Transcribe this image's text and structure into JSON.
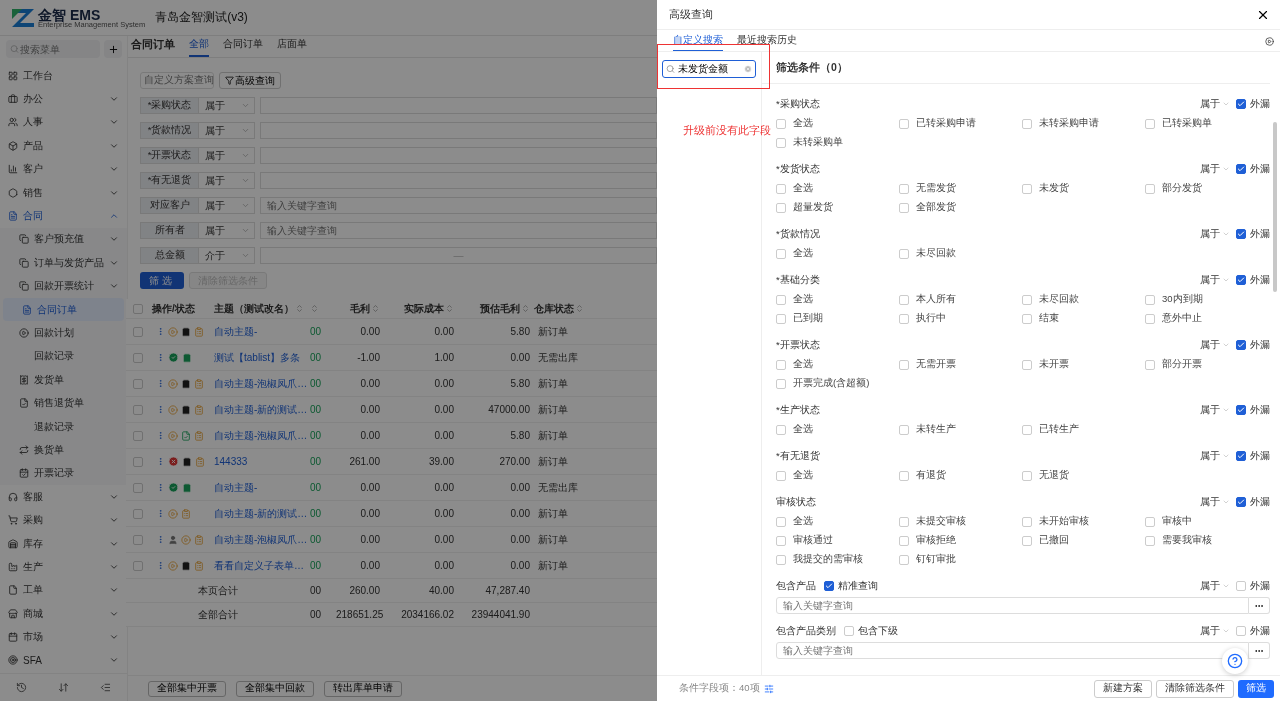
{
  "app": {
    "logo_text": "金智 EMS",
    "logo_subtitle": "Enterprise Management System",
    "title": "青岛金智测试(v3)"
  },
  "sidebar": {
    "search_placeholder": "搜索菜单",
    "items": [
      {
        "label": "工作台",
        "kind": "link",
        "selected": false
      },
      {
        "label": "办公",
        "kind": "group",
        "selected": false,
        "expanded": false
      },
      {
        "label": "人事",
        "kind": "group",
        "selected": false,
        "expanded": false
      },
      {
        "label": "产品",
        "kind": "group",
        "selected": false,
        "expanded": false
      },
      {
        "label": "客户",
        "kind": "group",
        "selected": false,
        "expanded": false
      },
      {
        "label": "销售",
        "kind": "group",
        "selected": false,
        "expanded": false
      },
      {
        "label": "合同",
        "kind": "group",
        "selected": false,
        "expanded": true,
        "children": [
          {
            "label": "客户预充值",
            "kind": "group",
            "selected": false,
            "expanded": false
          },
          {
            "label": "订单与发货产品",
            "kind": "group",
            "selected": false,
            "expanded": false
          },
          {
            "label": "回款开票统计",
            "kind": "group",
            "selected": false,
            "expanded": false
          },
          {
            "label": "合同订单",
            "kind": "link",
            "selected": true
          },
          {
            "label": "回款计划",
            "kind": "link",
            "selected": false
          },
          {
            "label": "回款记录",
            "kind": "plain",
            "selected": false
          },
          {
            "label": "发货单",
            "kind": "link",
            "selected": false
          },
          {
            "label": "销售退货单",
            "kind": "link",
            "selected": false
          },
          {
            "label": "退款记录",
            "kind": "plain",
            "selected": false
          },
          {
            "label": "换货单",
            "kind": "link",
            "selected": false
          },
          {
            "label": "开票记录",
            "kind": "link",
            "selected": false
          }
        ]
      },
      {
        "label": "客服",
        "kind": "group",
        "selected": false,
        "expanded": false
      },
      {
        "label": "采购",
        "kind": "group",
        "selected": false,
        "expanded": false
      },
      {
        "label": "库存",
        "kind": "group",
        "selected": false,
        "expanded": false
      },
      {
        "label": "生产",
        "kind": "group",
        "selected": false,
        "expanded": false
      },
      {
        "label": "工单",
        "kind": "group",
        "selected": false,
        "expanded": false
      },
      {
        "label": "商城",
        "kind": "group",
        "selected": false,
        "expanded": false
      },
      {
        "label": "市场",
        "kind": "group",
        "selected": false,
        "expanded": false
      },
      {
        "label": "SFA",
        "kind": "group",
        "selected": false,
        "expanded": false
      }
    ]
  },
  "page": {
    "title": "合同订单",
    "tabs": [
      {
        "label": "全部",
        "selected": true
      },
      {
        "label": "合同订单",
        "selected": false
      },
      {
        "label": "店面单",
        "selected": false
      }
    ]
  },
  "toolbar": {
    "scheme_placeholder": "自定义方案查询",
    "advanced_button": "高级查询"
  },
  "filters": [
    {
      "label": "*采购状态",
      "operator": "属于",
      "kind": "text"
    },
    {
      "label": "*货款情况",
      "operator": "属于",
      "kind": "text"
    },
    {
      "label": "*开票状态",
      "operator": "属于",
      "kind": "text"
    },
    {
      "label": "*有无退货",
      "operator": "属于",
      "kind": "text"
    },
    {
      "label": "对应客户",
      "operator": "属于",
      "kind": "text",
      "placeholder": "输入关键字查询"
    },
    {
      "label": "所有者",
      "operator": "属于",
      "kind": "text",
      "placeholder": "输入关键字查询"
    },
    {
      "label": "总金额",
      "operator": "介于",
      "kind": "range",
      "separator": "—"
    }
  ],
  "filter_buttons": {
    "apply": "筛选",
    "clear": "清除筛选条件"
  },
  "table": {
    "all_selected": false,
    "columns": [
      {
        "label": "操作/状态",
        "sortable": false
      },
      {
        "label": "主题（测试改名）",
        "sortable": true
      },
      {
        "sortable": true
      },
      {
        "label": "毛利",
        "sortable": true
      },
      {
        "label": "实际成本",
        "sortable": true
      },
      {
        "label": "预估毛利",
        "sortable": true
      },
      {
        "label": "仓库状态",
        "sortable": true
      }
    ],
    "rows": [
      {
        "selected": false,
        "icons": [
          {
            "kind": "pending"
          },
          {
            "kind": "bag"
          },
          {
            "kind": "note"
          }
        ],
        "subject": "自动主题-",
        "column_3": "00",
        "gross": "0.00",
        "cost": "0.00",
        "estimate": "5.80",
        "warehouse": "新订单"
      },
      {
        "selected": false,
        "icons": [
          {
            "kind": "approved"
          },
          {
            "kind": "bag-green"
          }
        ],
        "subject": "测试【tablist】多条",
        "column_3": "00",
        "gross": "-1.00",
        "cost": "1.00",
        "estimate": "0.00",
        "warehouse": "无需出库"
      },
      {
        "selected": false,
        "icons": [
          {
            "kind": "pending"
          },
          {
            "kind": "bag"
          },
          {
            "kind": "note"
          }
        ],
        "subject": "自动主题-泡椒凤爪…",
        "column_3": "00",
        "gross": "0.00",
        "cost": "0.00",
        "estimate": "5.80",
        "warehouse": "新订单"
      },
      {
        "selected": false,
        "icons": [
          {
            "kind": "pending"
          },
          {
            "kind": "bag"
          },
          {
            "kind": "note"
          }
        ],
        "subject": "自动主题-新的测试…",
        "column_3": "00",
        "gross": "0.00",
        "cost": "0.00",
        "estimate": "47000.00",
        "warehouse": "新订单"
      },
      {
        "selected": false,
        "icons": [
          {
            "kind": "pending"
          },
          {
            "kind": "doc-green"
          },
          {
            "kind": "note"
          }
        ],
        "subject": "自动主题-泡椒凤爪…",
        "column_3": "00",
        "gross": "0.00",
        "cost": "0.00",
        "estimate": "5.80",
        "warehouse": "新订单"
      },
      {
        "selected": false,
        "icons": [
          {
            "kind": "rejected"
          },
          {
            "kind": "bag"
          },
          {
            "kind": "note"
          }
        ],
        "subject": "144333",
        "column_3": "00",
        "gross": "261.00",
        "cost": "39.00",
        "estimate": "270.00",
        "warehouse": "新订单"
      },
      {
        "selected": false,
        "icons": [
          {
            "kind": "approved"
          },
          {
            "kind": "bag-green"
          }
        ],
        "subject": "自动主题-",
        "column_3": "00",
        "gross": "0.00",
        "cost": "0.00",
        "estimate": "0.00",
        "warehouse": "无需出库"
      },
      {
        "selected": false,
        "icons": [
          {
            "kind": "pending"
          },
          {
            "kind": "note"
          }
        ],
        "subject": "自动主题-新的测试…",
        "column_3": "00",
        "gross": "0.00",
        "cost": "0.00",
        "estimate": "0.00",
        "warehouse": "新订单"
      },
      {
        "selected": false,
        "icons": [
          {
            "kind": "person"
          },
          {
            "kind": "pending"
          },
          {
            "kind": "note"
          }
        ],
        "subject": "自动主题-泡椒凤爪…",
        "column_3": "00",
        "gross": "0.00",
        "cost": "0.00",
        "estimate": "0.00",
        "warehouse": "新订单"
      },
      {
        "selected": false,
        "icons": [
          {
            "kind": "pending"
          },
          {
            "kind": "bag"
          },
          {
            "kind": "note"
          }
        ],
        "subject": "看看自定义子表单…",
        "column_3": "00",
        "gross": "0.00",
        "cost": "0.00",
        "estimate": "0.00",
        "warehouse": "新订单"
      }
    ],
    "totals": [
      {
        "label": "本页合计",
        "column_3": "00",
        "gross": "260.00",
        "cost": "40.00",
        "estimate": "47,287.40"
      },
      {
        "label": "全部合计",
        "column_3": "00",
        "gross": "218651.25",
        "cost": "2034166.02",
        "estimate": "23944041.90"
      }
    ]
  },
  "bottom_buttons": [
    "全部集中开票",
    "全部集中回款",
    "转出库单申请"
  ],
  "drawer": {
    "title": "高级查询",
    "tabs": [
      {
        "label": "自定义搜索",
        "selected": true
      },
      {
        "label": "最近搜索历史",
        "selected": false
      }
    ],
    "field_search": {
      "value": "未发货金额"
    },
    "annotation": "升级前没有此字段",
    "conditions_title": "筛选条件（0）",
    "sections": [
      {
        "kind": "options",
        "label": "*采购状态",
        "operator": "属于",
        "show_label": "外漏",
        "exposed": true,
        "options": [
          {
            "label": "全选",
            "checked": false
          },
          {
            "label": "已转采购申请",
            "checked": false
          },
          {
            "label": "未转采购申请",
            "checked": false
          },
          {
            "label": "已转采购单",
            "checked": false
          },
          {
            "label": "未转采购单",
            "checked": false
          }
        ]
      },
      {
        "kind": "options",
        "label": "*发货状态",
        "operator": "属于",
        "show_label": "外漏",
        "exposed": true,
        "options": [
          {
            "label": "全选",
            "checked": false
          },
          {
            "label": "无需发货",
            "checked": false
          },
          {
            "label": "未发货",
            "checked": false
          },
          {
            "label": "部分发货",
            "checked": false
          },
          {
            "label": "超量发货",
            "checked": false
          },
          {
            "label": "全部发货",
            "checked": false
          }
        ]
      },
      {
        "kind": "options",
        "label": "*货款情况",
        "operator": "属于",
        "show_label": "外漏",
        "exposed": true,
        "options": [
          {
            "label": "全选",
            "checked": false
          },
          {
            "label": "未尽回款",
            "checked": false
          }
        ]
      },
      {
        "kind": "options",
        "label": "*基础分类",
        "operator": "属于",
        "show_label": "外漏",
        "exposed": true,
        "options": [
          {
            "label": "全选",
            "checked": false
          },
          {
            "label": "本人所有",
            "checked": false
          },
          {
            "label": "未尽回款",
            "checked": false
          },
          {
            "label": "30内到期",
            "checked": false
          },
          {
            "label": "已到期",
            "checked": false
          },
          {
            "label": "执行中",
            "checked": false
          },
          {
            "label": "结束",
            "checked": false
          },
          {
            "label": "意外中止",
            "checked": false
          }
        ]
      },
      {
        "kind": "options",
        "label": "*开票状态",
        "operator": "属于",
        "show_label": "外漏",
        "exposed": true,
        "options": [
          {
            "label": "全选",
            "checked": false
          },
          {
            "label": "无需开票",
            "checked": false
          },
          {
            "label": "未开票",
            "checked": false
          },
          {
            "label": "部分开票",
            "checked": false
          },
          {
            "label": "开票完成(含超额)",
            "checked": false
          }
        ]
      },
      {
        "kind": "options",
        "label": "*生产状态",
        "operator": "属于",
        "show_label": "外漏",
        "exposed": true,
        "options": [
          {
            "label": "全选",
            "checked": false
          },
          {
            "label": "未转生产",
            "checked": false
          },
          {
            "label": "已转生产",
            "checked": false
          }
        ]
      },
      {
        "kind": "options",
        "label": "*有无退货",
        "operator": "属于",
        "show_label": "外漏",
        "exposed": true,
        "options": [
          {
            "label": "全选",
            "checked": false
          },
          {
            "label": "有退货",
            "checked": false
          },
          {
            "label": "无退货",
            "checked": false
          }
        ]
      },
      {
        "kind": "options",
        "label": "审核状态",
        "operator": "属于",
        "show_label": "外漏",
        "exposed": true,
        "options": [
          {
            "label": "全选",
            "checked": false
          },
          {
            "label": "未提交审核",
            "checked": false
          },
          {
            "label": "未开始审核",
            "checked": false
          },
          {
            "label": "审核中",
            "checked": false
          },
          {
            "label": "审核通过",
            "checked": false
          },
          {
            "label": "审核拒绝",
            "checked": false
          },
          {
            "label": "已撤回",
            "checked": false
          },
          {
            "label": "需要我审核",
            "checked": false
          },
          {
            "label": "我提交的需审核",
            "checked": false
          },
          {
            "label": "钉钉审批",
            "checked": false
          }
        ]
      },
      {
        "kind": "keyword",
        "label": "包含产品",
        "toggle": {
          "label": "精准查询",
          "checked": true
        },
        "operator": "属于",
        "show_label": "外漏",
        "exposed": false,
        "placeholder": "输入关键字查询"
      },
      {
        "kind": "keyword",
        "label": "包含产品类别",
        "toggle": {
          "label": "包含下级",
          "checked": false
        },
        "operator": "属于",
        "show_label": "外漏",
        "exposed": false,
        "placeholder": "输入关键字查询"
      }
    ],
    "footer": {
      "field_count": "条件字段项：40项",
      "buttons": [
        {
          "label": "新建方案",
          "kind": "default"
        },
        {
          "label": "清除筛选条件",
          "kind": "default"
        },
        {
          "label": "筛选",
          "kind": "primary"
        }
      ]
    }
  }
}
